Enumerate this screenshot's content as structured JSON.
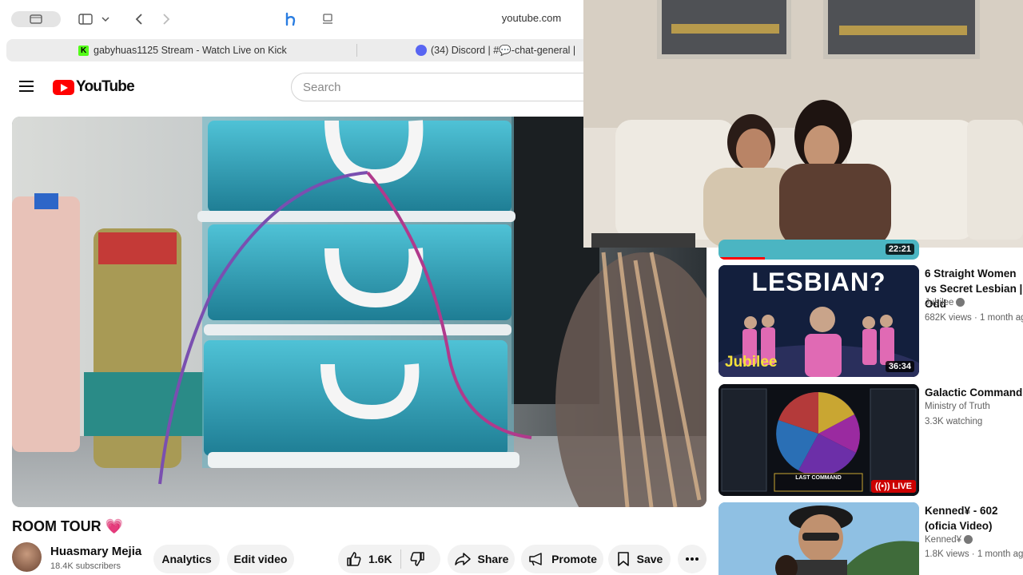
{
  "browser": {
    "url": "youtube.com",
    "tabs": [
      {
        "label": "gabyhuas1125 Stream - Watch Live on Kick",
        "favicon": "kick-icon"
      },
      {
        "label": "(34) Discord | #💬-chat-general |",
        "favicon": "discord-icon"
      }
    ]
  },
  "youtube": {
    "logo_text": "YouTube",
    "search_placeholder": "Search"
  },
  "video": {
    "title": "ROOM TOUR 💗",
    "channel": "Huasmary Mejia",
    "subscribers": "18.4K subscribers",
    "analytics_label": "Analytics",
    "edit_label": "Edit video",
    "likes": "1.6K",
    "share_label": "Share",
    "promote_label": "Promote",
    "save_label": "Save"
  },
  "sidebar": {
    "top_partial_duration": "22:21",
    "items": [
      {
        "title": "6 Straight Women vs Secret Lesbian | Odd",
        "channel": "Jubilee",
        "meta": "682K views · 1 month ag",
        "duration": "36:34",
        "thumb_text": "LESBIAN?",
        "brand": "Jubilee"
      },
      {
        "title": "Galactic Command",
        "channel": "Ministry of Truth",
        "meta": "3.3K watching",
        "live_label": "LIVE",
        "thumb_text": "LAST COMMAND"
      },
      {
        "title": "Kenned¥ - 602 (oficia Video)",
        "channel": "Kenned¥",
        "meta": "1.8K views · 1 month ago"
      }
    ]
  },
  "colors": {
    "brand_red": "#ff0000",
    "live_red": "#cc0000",
    "pill_bg": "#f2f2f2"
  }
}
